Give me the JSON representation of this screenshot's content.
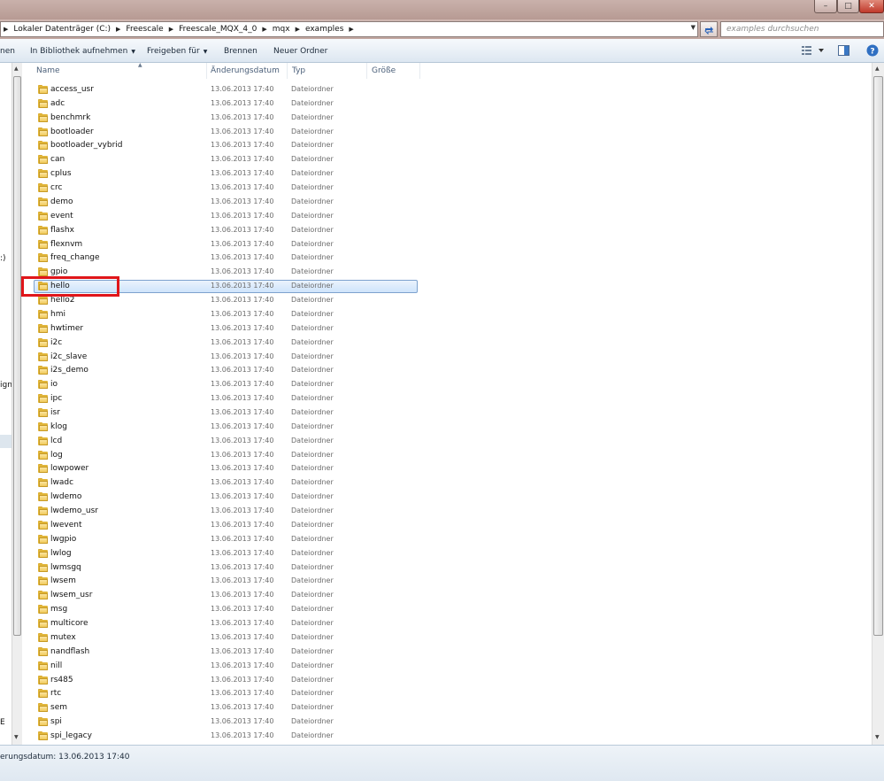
{
  "window": {
    "controls": {
      "minimize": "–",
      "maximize": "□",
      "close": "✕"
    }
  },
  "address": {
    "breadcrumbs": [
      "Lokaler Datenträger (C:)",
      "Freescale",
      "Freescale_MQX_4_0",
      "mqx",
      "examples"
    ],
    "search_placeholder": "examples durchsuchen",
    "refresh_icon": "refresh-arrows-icon"
  },
  "toolbar": {
    "organize_fragment": "nen",
    "library_label": "In Bibliothek aufnehmen",
    "share_label": "Freigeben für",
    "burn_label": "Brennen",
    "new_folder_label": "Neuer Ordner",
    "dropdown_glyph": "▼"
  },
  "navpane": {
    "fragments": [
      ":)",
      "ign",
      "E"
    ]
  },
  "columns": {
    "name": "Name",
    "date": "Änderungsdatum",
    "type": "Typ",
    "size": "Größe"
  },
  "files": [
    {
      "name": "access_usr",
      "date": "13.06.2013 17:40",
      "type": "Dateiordner"
    },
    {
      "name": "adc",
      "date": "13.06.2013 17:40",
      "type": "Dateiordner"
    },
    {
      "name": "benchmrk",
      "date": "13.06.2013 17:40",
      "type": "Dateiordner"
    },
    {
      "name": "bootloader",
      "date": "13.06.2013 17:40",
      "type": "Dateiordner"
    },
    {
      "name": "bootloader_vybrid",
      "date": "13.06.2013 17:40",
      "type": "Dateiordner"
    },
    {
      "name": "can",
      "date": "13.06.2013 17:40",
      "type": "Dateiordner"
    },
    {
      "name": "cplus",
      "date": "13.06.2013 17:40",
      "type": "Dateiordner"
    },
    {
      "name": "crc",
      "date": "13.06.2013 17:40",
      "type": "Dateiordner"
    },
    {
      "name": "demo",
      "date": "13.06.2013 17:40",
      "type": "Dateiordner"
    },
    {
      "name": "event",
      "date": "13.06.2013 17:40",
      "type": "Dateiordner"
    },
    {
      "name": "flashx",
      "date": "13.06.2013 17:40",
      "type": "Dateiordner"
    },
    {
      "name": "flexnvm",
      "date": "13.06.2013 17:40",
      "type": "Dateiordner"
    },
    {
      "name": "freq_change",
      "date": "13.06.2013 17:40",
      "type": "Dateiordner"
    },
    {
      "name": "gpio",
      "date": "13.06.2013 17:40",
      "type": "Dateiordner"
    },
    {
      "name": "hello",
      "date": "13.06.2013 17:40",
      "type": "Dateiordner",
      "selected": true
    },
    {
      "name": "hello2",
      "date": "13.06.2013 17:40",
      "type": "Dateiordner"
    },
    {
      "name": "hmi",
      "date": "13.06.2013 17:40",
      "type": "Dateiordner"
    },
    {
      "name": "hwtimer",
      "date": "13.06.2013 17:40",
      "type": "Dateiordner"
    },
    {
      "name": "i2c",
      "date": "13.06.2013 17:40",
      "type": "Dateiordner"
    },
    {
      "name": "i2c_slave",
      "date": "13.06.2013 17:40",
      "type": "Dateiordner"
    },
    {
      "name": "i2s_demo",
      "date": "13.06.2013 17:40",
      "type": "Dateiordner"
    },
    {
      "name": "io",
      "date": "13.06.2013 17:40",
      "type": "Dateiordner"
    },
    {
      "name": "ipc",
      "date": "13.06.2013 17:40",
      "type": "Dateiordner"
    },
    {
      "name": "isr",
      "date": "13.06.2013 17:40",
      "type": "Dateiordner"
    },
    {
      "name": "klog",
      "date": "13.06.2013 17:40",
      "type": "Dateiordner"
    },
    {
      "name": "lcd",
      "date": "13.06.2013 17:40",
      "type": "Dateiordner"
    },
    {
      "name": "log",
      "date": "13.06.2013 17:40",
      "type": "Dateiordner"
    },
    {
      "name": "lowpower",
      "date": "13.06.2013 17:40",
      "type": "Dateiordner"
    },
    {
      "name": "lwadc",
      "date": "13.06.2013 17:40",
      "type": "Dateiordner"
    },
    {
      "name": "lwdemo",
      "date": "13.06.2013 17:40",
      "type": "Dateiordner"
    },
    {
      "name": "lwdemo_usr",
      "date": "13.06.2013 17:40",
      "type": "Dateiordner"
    },
    {
      "name": "lwevent",
      "date": "13.06.2013 17:40",
      "type": "Dateiordner"
    },
    {
      "name": "lwgpio",
      "date": "13.06.2013 17:40",
      "type": "Dateiordner"
    },
    {
      "name": "lwlog",
      "date": "13.06.2013 17:40",
      "type": "Dateiordner"
    },
    {
      "name": "lwmsgq",
      "date": "13.06.2013 17:40",
      "type": "Dateiordner"
    },
    {
      "name": "lwsem",
      "date": "13.06.2013 17:40",
      "type": "Dateiordner"
    },
    {
      "name": "lwsem_usr",
      "date": "13.06.2013 17:40",
      "type": "Dateiordner"
    },
    {
      "name": "msg",
      "date": "13.06.2013 17:40",
      "type": "Dateiordner"
    },
    {
      "name": "multicore",
      "date": "13.06.2013 17:40",
      "type": "Dateiordner"
    },
    {
      "name": "mutex",
      "date": "13.06.2013 17:40",
      "type": "Dateiordner"
    },
    {
      "name": "nandflash",
      "date": "13.06.2013 17:40",
      "type": "Dateiordner"
    },
    {
      "name": "nill",
      "date": "13.06.2013 17:40",
      "type": "Dateiordner"
    },
    {
      "name": "rs485",
      "date": "13.06.2013 17:40",
      "type": "Dateiordner"
    },
    {
      "name": "rtc",
      "date": "13.06.2013 17:40",
      "type": "Dateiordner"
    },
    {
      "name": "sem",
      "date": "13.06.2013 17:40",
      "type": "Dateiordner"
    },
    {
      "name": "spi",
      "date": "13.06.2013 17:40",
      "type": "Dateiordner"
    },
    {
      "name": "spi_legacy",
      "date": "13.06.2013 17:40",
      "type": "Dateiordner"
    }
  ],
  "status": {
    "text": "erungsdatum: 13.06.2013 17:40"
  },
  "colors": {
    "selection_border": "#7da2ce",
    "highlight_annotation": "#e0161a",
    "folder": "#e1b63a"
  }
}
